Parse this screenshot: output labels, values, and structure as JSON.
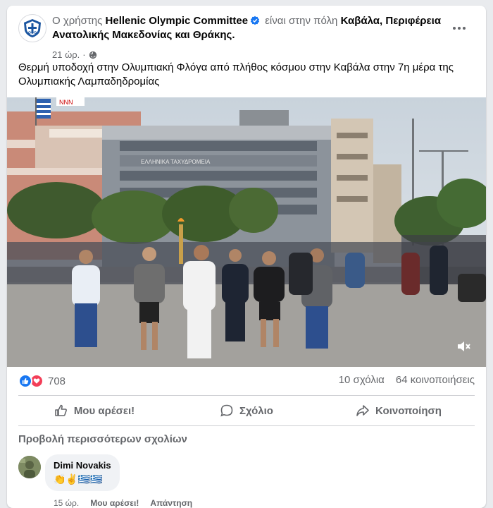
{
  "post": {
    "prefix": "Ο χρήστης",
    "author": "Hellenic Olympic Committee",
    "middle": "είναι στην πόλη",
    "location": "Καβάλα, Περιφέρεια Ανατολικής Μακεδονίας και Θράκης.",
    "time": "21 ώρ.",
    "dot": "·",
    "caption": "Θερμή υποδοχή στην Ολυμπιακή Φλόγα από πλήθος κόσμου στην Καβάλα στην 7η μέρα της Ολυμπιακής Λαμπαδηδρομίας",
    "video_sign_building": "ΕΛΛΗΝΙΚΑ ΤΑΧΥΔΡΟΜΕΙΑ",
    "video_sign_roof": "NNN"
  },
  "stats": {
    "reactions_count": "708",
    "comments": "10 σχόλια",
    "shares": "64 κοινοποιήσεις"
  },
  "actions": {
    "like": "Μου αρέσει!",
    "comment": "Σχόλιο",
    "share": "Κοινοποίηση"
  },
  "comments": {
    "view_more": "Προβολή περισσότερων σχολίων",
    "items": [
      {
        "name": "Dimi Novakis",
        "text": "👏✌️🇬🇷🇬🇷",
        "time": "15 ώρ.",
        "like": "Μου αρέσει!",
        "reply": "Απάντηση"
      }
    ]
  },
  "colors": {
    "accent": "#1877f2",
    "love": "#f33e58",
    "muted": "#65676b"
  },
  "icons": [
    "hoc-logo-icon",
    "verified-badge-icon",
    "globe-icon",
    "more-options-icon",
    "mute-icon",
    "like-reaction-icon",
    "love-reaction-icon",
    "thumbs-up-icon",
    "comment-icon",
    "share-icon"
  ]
}
